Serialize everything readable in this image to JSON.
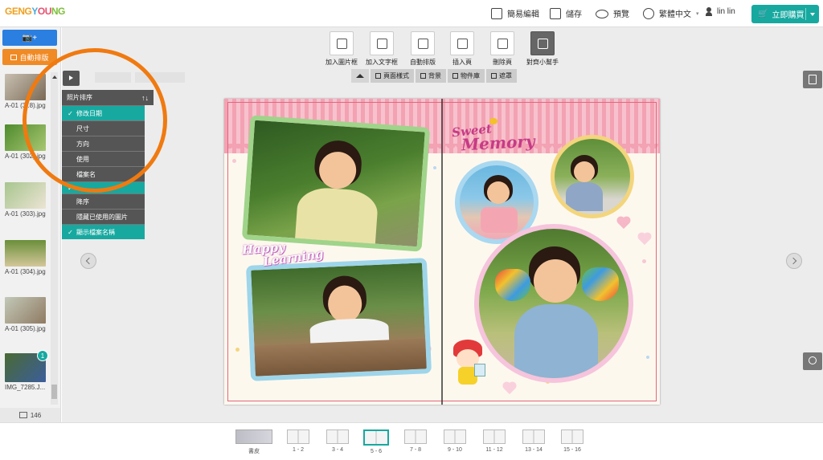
{
  "header": {
    "logo_text": "GENGYOUNG",
    "logo_parts": [
      "GENG",
      "Y",
      "OU",
      "NG"
    ],
    "items": [
      {
        "label": "簡易編輯",
        "icon": "share-edit-icon"
      },
      {
        "label": "儲存",
        "icon": "save-icon"
      },
      {
        "label": "預覽",
        "icon": "eye-icon"
      },
      {
        "label": "繁體中文",
        "icon": "globe-icon"
      },
      {
        "label": "lin lin",
        "icon": "user-icon"
      }
    ],
    "buy_label": "立即購買"
  },
  "left": {
    "upload_label": "📷+",
    "auto_layout_label": "自動排版",
    "thumbs": [
      {
        "caption": "A-01 (3..8).jpg",
        "colors": [
          "#c9c0b2",
          "#7a6a55"
        ]
      },
      {
        "caption": "A-01 (302).jpg",
        "colors": [
          "#4f8b2e",
          "#a9c773"
        ]
      },
      {
        "caption": "A-01 (303).jpg",
        "colors": [
          "#a7c58e",
          "#ece4d4"
        ]
      },
      {
        "caption": "A-01 (304).jpg",
        "colors": [
          "#6a8f3a",
          "#d4c79a"
        ]
      },
      {
        "caption": "A-01 (305).jpg",
        "colors": [
          "#c3c9b8",
          "#8f7a62"
        ]
      },
      {
        "caption": "IMG_7285.J...",
        "colors": [
          "#4a6a32",
          "#3b5e9c"
        ],
        "badge": "1"
      }
    ],
    "photo_count": "146"
  },
  "toolbar": {
    "tools": [
      {
        "label": "加入圖片框",
        "icon": "add-image-frame-icon"
      },
      {
        "label": "加入文字框",
        "icon": "add-text-frame-icon"
      },
      {
        "label": "自動排版",
        "icon": "auto-layout-icon"
      },
      {
        "label": "插入頁",
        "icon": "insert-page-icon"
      },
      {
        "label": "刪除頁",
        "icon": "delete-page-icon"
      },
      {
        "label": "對齊小幫手",
        "icon": "align-helper-icon",
        "active": true
      }
    ],
    "tabs": [
      {
        "label": "頁面樣式",
        "icon": "page-style-icon"
      },
      {
        "label": "背景",
        "icon": "background-icon"
      },
      {
        "label": "物件庫",
        "icon": "object-library-icon"
      },
      {
        "label": "遮罩",
        "icon": "mask-icon"
      }
    ]
  },
  "sort_menu": {
    "title": "照片排序",
    "sort_icon": "↑↓",
    "items": [
      {
        "label": "修改日期",
        "checked": true,
        "teal": true
      },
      {
        "label": "尺寸",
        "checked": false,
        "teal": false
      },
      {
        "label": "方向",
        "checked": false,
        "teal": false
      },
      {
        "label": "使用",
        "checked": false,
        "teal": false
      },
      {
        "label": "檔案名",
        "checked": false,
        "teal": false
      }
    ],
    "lower_items": [
      {
        "label": "",
        "checked": true,
        "teal": true
      },
      {
        "label": "降序",
        "checked": false,
        "teal": false
      },
      {
        "label": "隱藏已使用的圖片",
        "checked": false,
        "teal": false
      },
      {
        "label": "顯示檔案名稱",
        "checked": true,
        "teal": true
      }
    ],
    "check_glyph": "✓"
  },
  "album": {
    "sweet_line1": "Sweet",
    "sweet_line2": "Memory",
    "happy_line1": "Happy",
    "happy_line2": "Learning"
  },
  "pages": [
    {
      "label": "書皮",
      "cover": true
    },
    {
      "label": "1 - 2"
    },
    {
      "label": "3 - 4"
    },
    {
      "label": "5 - 6",
      "current": true
    },
    {
      "label": "7 - 8"
    },
    {
      "label": "9 - 10"
    },
    {
      "label": "11 - 12"
    },
    {
      "label": "13 - 14"
    },
    {
      "label": "15 - 16"
    }
  ],
  "colors": {
    "accent": "#17a9a0",
    "upload": "#2b7fe0",
    "auto_layout": "#f08a24",
    "ring": "#f07a10"
  }
}
